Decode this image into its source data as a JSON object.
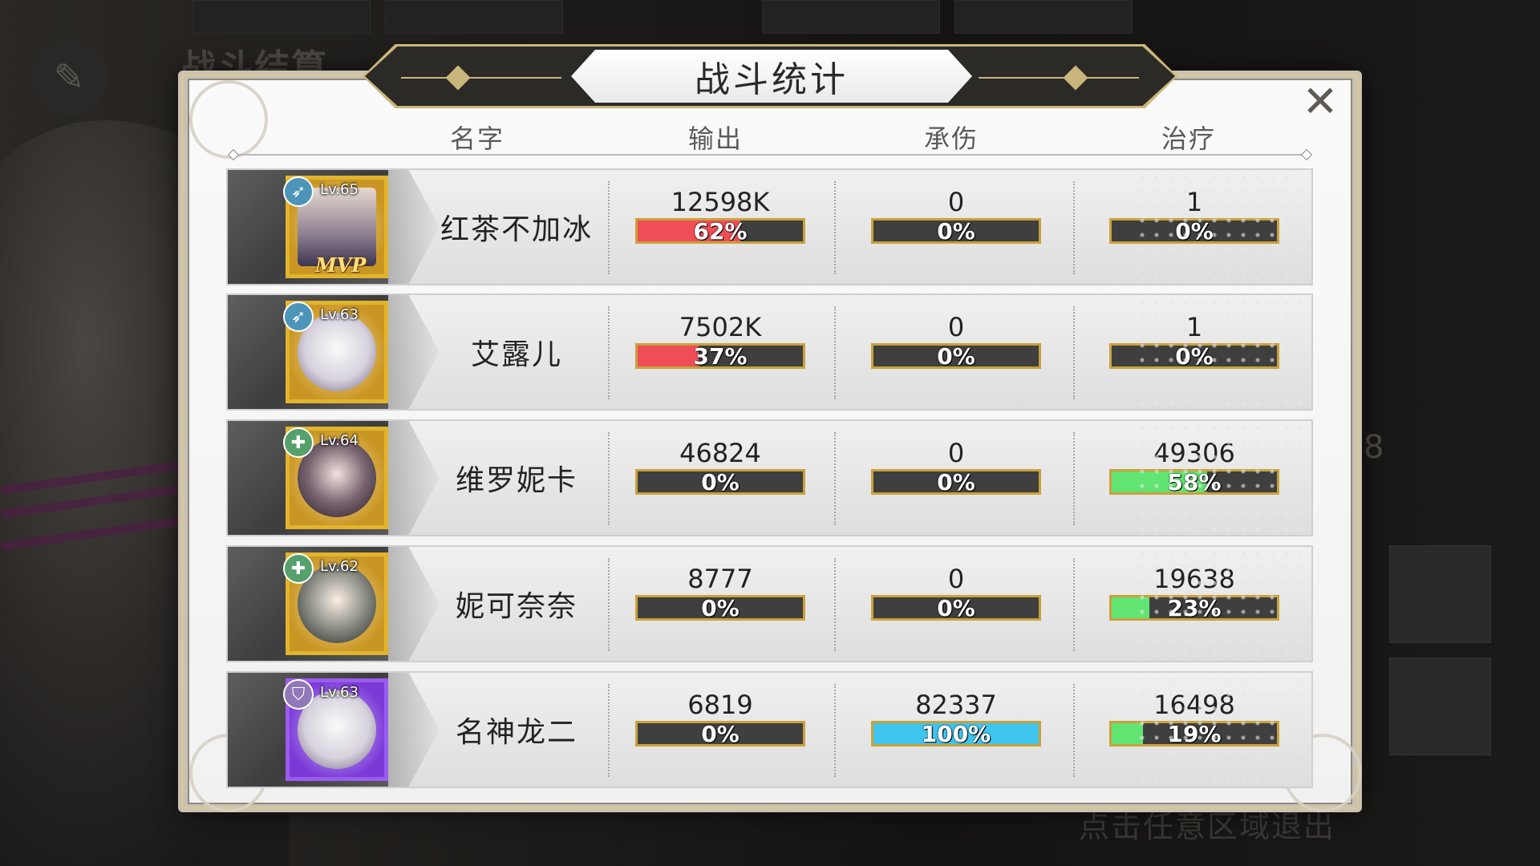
{
  "background": {
    "title": "战斗结算",
    "exit_hint": "点击任意区域退出",
    "side_number": "8"
  },
  "panel": {
    "title": "战斗统计",
    "close_symbol": "✕"
  },
  "columns": {
    "name": "名字",
    "damage": "输出",
    "taken": "承伤",
    "heal": "治疗"
  },
  "colors": {
    "damage_bar": "#f04e57",
    "taken_bar": "#3fc4ee",
    "heal_bar": "#62e473",
    "bar_border": "#c9a23a",
    "frame_gold": "#e2b42d",
    "frame_purple": "#9a5cf0"
  },
  "rows": [
    {
      "level": "Lv.65",
      "class_icon": "bow-icon",
      "frame": "gold",
      "mvp": "MVP",
      "name": "红茶不加冰",
      "damage": "12598K",
      "damage_pct": "62%",
      "damage_ratio": 0.62,
      "taken": "0",
      "taken_pct": "0%",
      "taken_ratio": 0,
      "heal": "1",
      "heal_pct": "0%",
      "heal_ratio": 0
    },
    {
      "level": "Lv.63",
      "class_icon": "bow-icon",
      "frame": "gold",
      "mvp": "",
      "name": "艾露儿",
      "damage": "7502K",
      "damage_pct": "37%",
      "damage_ratio": 0.37,
      "taken": "0",
      "taken_pct": "0%",
      "taken_ratio": 0,
      "heal": "1",
      "heal_pct": "0%",
      "heal_ratio": 0
    },
    {
      "level": "Lv.64",
      "class_icon": "heal-cross-icon",
      "frame": "gold",
      "mvp": "",
      "name": "维罗妮卡",
      "damage": "46824",
      "damage_pct": "0%",
      "damage_ratio": 0,
      "taken": "0",
      "taken_pct": "0%",
      "taken_ratio": 0,
      "heal": "49306",
      "heal_pct": "58%",
      "heal_ratio": 0.58
    },
    {
      "level": "Lv.62",
      "class_icon": "heal-cross-icon",
      "frame": "gold",
      "mvp": "",
      "name": "妮可奈奈",
      "damage": "8777",
      "damage_pct": "0%",
      "damage_ratio": 0,
      "taken": "0",
      "taken_pct": "0%",
      "taken_ratio": 0,
      "heal": "19638",
      "heal_pct": "23%",
      "heal_ratio": 0.23
    },
    {
      "level": "Lv.63",
      "class_icon": "shield-icon",
      "frame": "purple",
      "mvp": "",
      "name": "名神龙二",
      "damage": "6819",
      "damage_pct": "0%",
      "damage_ratio": 0,
      "taken": "82337",
      "taken_pct": "100%",
      "taken_ratio": 1,
      "heal": "16498",
      "heal_pct": "19%",
      "heal_ratio": 0.19
    }
  ]
}
